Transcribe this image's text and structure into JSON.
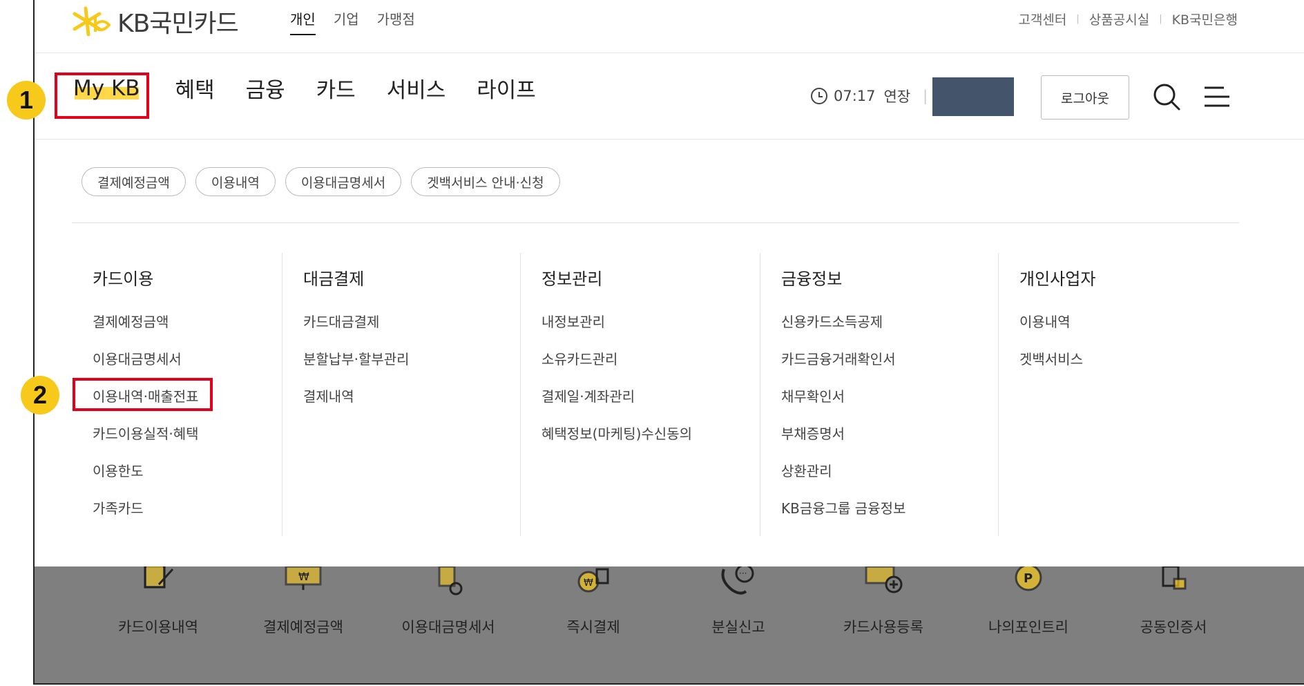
{
  "brand": {
    "name": "KB국민카드",
    "accent": "#f7c91a",
    "highlight_color": "#e3001b"
  },
  "topbar": {
    "segments": [
      "개인",
      "기업",
      "가맹점"
    ],
    "active_segment": "개인",
    "utility_links": [
      "고객센터",
      "상품공시실",
      "KB국민은행"
    ]
  },
  "gnb": {
    "items": [
      "My KB",
      "혜택",
      "금융",
      "카드",
      "서비스",
      "라이프"
    ],
    "timer": "07:17",
    "extend_label": "연장",
    "logout_label": "로그아웃"
  },
  "chips": [
    "결제예정금액",
    "이용내역",
    "이용대금명세서",
    "겟백서비스 안내·신청"
  ],
  "menu_columns": [
    {
      "title": "카드이용",
      "items": [
        "결제예정금액",
        "이용대금명세서",
        "이용내역·매출전표",
        "카드이용실적·혜택",
        "이용한도",
        "가족카드"
      ]
    },
    {
      "title": "대금결제",
      "items": [
        "카드대금결제",
        "분할납부·할부관리",
        "결제내역"
      ]
    },
    {
      "title": "정보관리",
      "items": [
        "내정보관리",
        "소유카드관리",
        "결제일·계좌관리",
        "혜택정보(마케팅)수신동의"
      ]
    },
    {
      "title": "금융정보",
      "items": [
        "신용카드소득공제",
        "카드금융거래확인서",
        "채무확인서",
        "부채증명서",
        "상환관리",
        "KB금융그룹 금융정보"
      ]
    },
    {
      "title": "개인사업자",
      "items": [
        "이용내역",
        "겟백서비스"
      ]
    }
  ],
  "quick_icons": [
    {
      "label": "카드이용내역",
      "icon": "document-pen-icon"
    },
    {
      "label": "결제예정금액",
      "icon": "won-monitor-icon"
    },
    {
      "label": "이용대금명세서",
      "icon": "statement-check-icon"
    },
    {
      "label": "즉시결제",
      "icon": "won-coin-stack-icon"
    },
    {
      "label": "분실신고",
      "icon": "phone-call-icon"
    },
    {
      "label": "카드사용등록",
      "icon": "card-add-icon"
    },
    {
      "label": "나의포인트리",
      "icon": "point-coin-icon"
    },
    {
      "label": "공동인증서",
      "icon": "certificate-lock-icon"
    }
  ],
  "steps": [
    "1",
    "2"
  ]
}
